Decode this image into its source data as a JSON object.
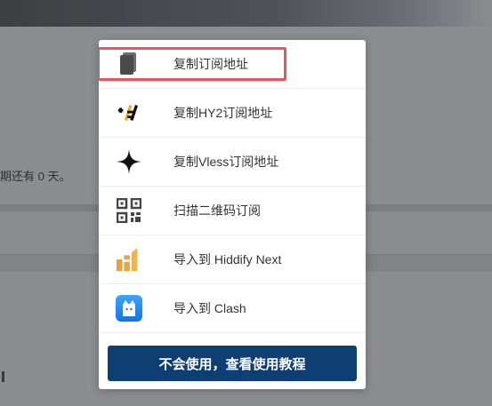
{
  "background": {
    "expiry_text": "期还有 0 天。"
  },
  "modal": {
    "items": [
      {
        "label": "复制订阅地址",
        "icon": "copy-icon"
      },
      {
        "label": "复制HY2订阅地址",
        "icon": "hysteria2-icon"
      },
      {
        "label": "复制Vless订阅地址",
        "icon": "vless-star-icon"
      },
      {
        "label": "扫描二维码订阅",
        "icon": "qr-code-icon"
      },
      {
        "label": "导入到 Hiddify Next",
        "icon": "hiddify-icon"
      },
      {
        "label": "导入到 Clash",
        "icon": "clash-cat-icon"
      }
    ],
    "tutorial_button": "不会使用，查看使用教程"
  },
  "colors": {
    "primary_button": "#0e3f72",
    "highlight": "#e4585c",
    "hiddify_orange": "#f0a33e",
    "clash_blue": "#1e90ff"
  }
}
